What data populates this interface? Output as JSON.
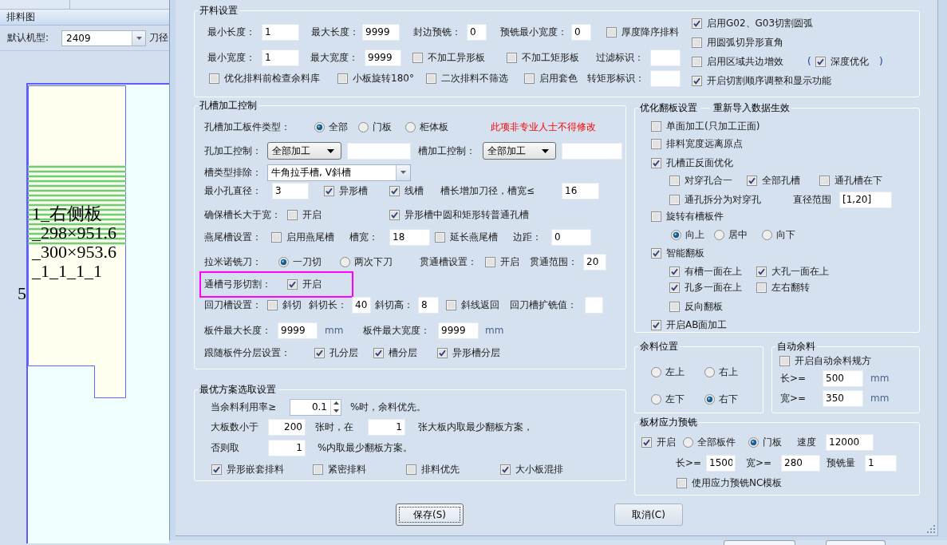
{
  "left_panel": {
    "title": "排料图",
    "machine_type": {
      "label": "默认机型:",
      "value": "2409"
    },
    "blade_label": "刀径",
    "layout": {
      "part_label_lines": [
        "1_右侧板",
        "_298×951.6",
        "_300×953.6",
        "_1_1_1_1"
      ],
      "sheet_number": "5"
    }
  },
  "dialog": {
    "groups": [
      {
        "title": "开料设置",
        "columns": [
          {
            "rows": [
              {
                "items": [
                  {
                    "kind": "label",
                    "text": "最小长度："
                  },
                  {
                    "kind": "input",
                    "value": "1"
                  },
                  {
                    "kind": "label",
                    "text": "最大长度："
                  },
                  {
                    "kind": "input",
                    "value": "9999"
                  },
                  {
                    "kind": "label",
                    "text": "封边预铣："
                  },
                  {
                    "kind": "input",
                    "value": "0"
                  },
                  {
                    "kind": "label",
                    "text": "预铣最小宽度："
                  },
                  {
                    "kind": "input",
                    "value": "0"
                  },
                  {
                    "kind": "checkbox",
                    "label": "厚度降序排料",
                    "checked": false
                  }
                ]
              },
              {
                "items": [
                  {
                    "kind": "label",
                    "text": "最小宽度："
                  },
                  {
                    "kind": "input",
                    "value": "1"
                  },
                  {
                    "kind": "label",
                    "text": "最大宽度："
                  },
                  {
                    "kind": "input",
                    "value": "9999"
                  },
                  {
                    "kind": "checkbox",
                    "label": "不加工异形板",
                    "checked": false
                  },
                  {
                    "kind": "checkbox",
                    "label": "不加工矩形板",
                    "checked": false
                  },
                  {
                    "kind": "label",
                    "text": "过滤标识："
                  },
                  {
                    "kind": "input"
                  }
                ]
              },
              {
                "items": [
                  {
                    "kind": "checkbox",
                    "label": "优化排料前检查余料库",
                    "checked": false
                  },
                  {
                    "kind": "checkbox",
                    "label": "小板旋转180°",
                    "checked": false
                  },
                  {
                    "kind": "checkbox",
                    "label": "二次排料不筛选",
                    "checked": false
                  },
                  {
                    "kind": "checkbox",
                    "label": "启用套色",
                    "checked": false
                  },
                  {
                    "kind": "label",
                    "text": "转矩形标识："
                  },
                  {
                    "kind": "input"
                  }
                ]
              }
            ]
          },
          {
            "rows": [
              {
                "items": [
                  {
                    "kind": "checkbox",
                    "label": "启用G02、G03切割圆弧",
                    "checked": true
                  }
                ]
              },
              {
                "items": [
                  {
                    "kind": "checkbox",
                    "label": "用圆弧切异形直角",
                    "checked": false
                  }
                ]
              },
              {
                "items": [
                  {
                    "kind": "checkbox",
                    "label": "启用区域共边增效",
                    "checked": false
                  },
                  {
                    "kind": "symbol",
                    "text": "("
                  },
                  {
                    "kind": "checkbox",
                    "label": "深度优化",
                    "checked": true
                  },
                  {
                    "kind": "symbol",
                    "text": ")"
                  }
                ]
              },
              {
                "items": [
                  {
                    "kind": "checkbox",
                    "label": "开启切割顺序调整和显示功能",
                    "checked": true
                  }
                ]
              }
            ]
          }
        ]
      },
      {
        "title": "孔槽加工控制",
        "rows": [
          {
            "highlighted": false,
            "items": [
              {
                "kind": "label",
                "text": "孔槽加工板件类型："
              },
              {
                "kind": "radio",
                "label": "全部",
                "selected": true
              },
              {
                "kind": "radio",
                "label": "门板",
                "selected": false
              },
              {
                "kind": "radio",
                "label": "柜体板",
                "selected": false
              },
              {
                "kind": "warning",
                "text": "此项非专业人士不得修改"
              }
            ]
          },
          {
            "highlighted": false,
            "items": [
              {
                "kind": "label",
                "text": "孔加工控制："
              },
              {
                "kind": "select",
                "value": "全部加工"
              },
              {
                "kind": "input"
              },
              {
                "kind": "label",
                "text": "槽加工控制："
              },
              {
                "kind": "select",
                "value": "全部加工"
              },
              {
                "kind": "input"
              }
            ]
          },
          {
            "highlighted": false,
            "items": [
              {
                "kind": "label",
                "text": "槽类型排除："
              },
              {
                "kind": "combo",
                "value": "牛角拉手槽, V斜槽"
              }
            ]
          },
          {
            "highlighted": false,
            "items": [
              {
                "kind": "label",
                "text": "最小孔直径："
              },
              {
                "kind": "input",
                "value": "3"
              },
              {
                "kind": "checkbox",
                "label": "异形槽",
                "checked": true
              },
              {
                "kind": "checkbox",
                "label": "线槽",
                "checked": true
              },
              {
                "kind": "label",
                "text": "槽长增加刀径，槽宽≤"
              },
              {
                "kind": "input",
                "value": "16"
              }
            ]
          },
          {
            "highlighted": false,
            "items": [
              {
                "kind": "label",
                "text": "确保槽长大于宽："
              },
              {
                "kind": "checkbox",
                "label": "开启",
                "checked": false
              },
              {
                "kind": "checkbox",
                "label": "异形槽中圆和矩形转普通孔槽",
                "checked": true
              }
            ]
          },
          {
            "highlighted": false,
            "items": [
              {
                "kind": "label",
                "text": "燕尾槽设置："
              },
              {
                "kind": "checkbox",
                "label": "启用燕尾槽",
                "checked": false
              },
              {
                "kind": "label",
                "text": "槽宽："
              },
              {
                "kind": "input",
                "value": "18"
              },
              {
                "kind": "checkbox",
                "label": "延长燕尾槽",
                "checked": false
              },
              {
                "kind": "label",
                "text": "边距："
              },
              {
                "kind": "input",
                "value": "0"
              }
            ]
          },
          {
            "highlighted": false,
            "items": [
              {
                "kind": "label",
                "text": "拉米诺铣刀："
              },
              {
                "kind": "radio",
                "label": "一刀切",
                "selected": true
              },
              {
                "kind": "radio",
                "label": "两次下刀",
                "selected": false
              },
              {
                "kind": "label",
                "text": "贯通槽设置："
              },
              {
                "kind": "checkbox",
                "label": "开启",
                "checked": false
              },
              {
                "kind": "label",
                "text": "贯通范围："
              },
              {
                "kind": "input",
                "value": "20"
              }
            ]
          },
          {
            "highlighted": true,
            "items": [
              {
                "kind": "label",
                "text": "通槽弓形切割："
              },
              {
                "kind": "checkbox",
                "label": "开启",
                "checked": true
              }
            ]
          },
          {
            "highlighted": false,
            "items": [
              {
                "kind": "label",
                "text": "回刀槽设置："
              },
              {
                "kind": "checkbox",
                "label": "斜切",
                "checked": false
              },
              {
                "kind": "label",
                "text": "斜切长："
              },
              {
                "kind": "input",
                "value": "40"
              },
              {
                "kind": "label",
                "text": "斜切高："
              },
              {
                "kind": "input",
                "value": "8"
              },
              {
                "kind": "checkbox",
                "label": "斜线返回",
                "checked": false
              },
              {
                "kind": "label",
                "text": "回刀槽扩铣值："
              },
              {
                "kind": "input"
              }
            ]
          },
          {
            "highlighted": false,
            "items": [
              {
                "kind": "label",
                "text": "板件最大长度："
              },
              {
                "kind": "input",
                "value": "9999"
              },
              {
                "kind": "unit",
                "text": "mm"
              },
              {
                "kind": "label",
                "text": "板件最大宽度："
              },
              {
                "kind": "input",
                "value": "9999"
              },
              {
                "kind": "unit",
                "text": "mm"
              }
            ]
          },
          {
            "highlighted": false,
            "items": [
              {
                "kind": "label",
                "text": "跟随板件分层设置："
              },
              {
                "kind": "checkbox",
                "label": "孔分层",
                "checked": true
              },
              {
                "kind": "checkbox",
                "label": "槽分层",
                "checked": true
              },
              {
                "kind": "checkbox",
                "label": "异形槽分层",
                "checked": true
              }
            ]
          }
        ]
      },
      {
        "title": "最优方案选取设置",
        "rows": [
          {
            "items": [
              {
                "kind": "label",
                "text": "当余料利用率≥"
              },
              {
                "kind": "spinner",
                "value": "0.1"
              },
              {
                "kind": "label",
                "text": "%时，余料优先。"
              }
            ]
          },
          {
            "items": [
              {
                "kind": "label",
                "text": "大板数小于"
              },
              {
                "kind": "number",
                "value": "200"
              },
              {
                "kind": "label",
                "text": "张时，在"
              },
              {
                "kind": "number",
                "value": "1"
              },
              {
                "kind": "label",
                "text": "张大板内取最少翻板方案，"
              }
            ]
          },
          {
            "items": [
              {
                "kind": "label",
                "text": "否则取"
              },
              {
                "kind": "number",
                "value": "1"
              },
              {
                "kind": "label",
                "text": "%内取最少翻板方案。"
              }
            ]
          },
          {
            "items": [
              {
                "kind": "checkbox",
                "label": "异形嵌套排料",
                "checked": true
              },
              {
                "kind": "checkbox",
                "label": "紧密排料",
                "checked": false
              },
              {
                "kind": "checkbox",
                "label": "排料优先",
                "checked": false
              },
              {
                "kind": "checkbox",
                "label": "大小板混排",
                "checked": true
              }
            ]
          }
        ]
      },
      {
        "title": "优化翻板设置",
        "note": "重新导入数据生效",
        "rows": [
          {
            "items": [
              {
                "kind": "checkbox",
                "label": "单面加工(只加工正面)",
                "checked": false
              }
            ]
          },
          {
            "items": [
              {
                "kind": "checkbox",
                "label": "排料宽度远离原点",
                "checked": false
              }
            ]
          },
          {
            "items": [
              {
                "kind": "checkbox",
                "label": "孔槽正反面优化",
                "checked": true
              }
            ],
            "children": [
              {
                "items": [
                  {
                    "kind": "checkbox",
                    "label": "对穿孔合一",
                    "checked": false
                  },
                  {
                    "kind": "checkbox",
                    "label": "全部孔槽",
                    "checked": true
                  },
                  {
                    "kind": "checkbox",
                    "label": "通孔槽在下",
                    "checked": false
                  }
                ]
              },
              {
                "items": [
                  {
                    "kind": "checkbox",
                    "label": "通孔拆分为对穿孔",
                    "checked": false
                  },
                  {
                    "kind": "label",
                    "text": "直径范围"
                  },
                  {
                    "kind": "input",
                    "value": "[1,20]"
                  }
                ]
              }
            ]
          },
          {
            "items": [
              {
                "kind": "checkbox",
                "label": "旋转有槽板件",
                "checked": false
              }
            ],
            "children": [
              {
                "items": [
                  {
                    "kind": "radio",
                    "label": "向上",
                    "selected": true
                  },
                  {
                    "kind": "radio",
                    "label": "居中",
                    "selected": false
                  },
                  {
                    "kind": "radio",
                    "label": "向下",
                    "selected": false
                  }
                ]
              }
            ]
          },
          {
            "items": [
              {
                "kind": "checkbox",
                "label": "智能翻板",
                "checked": true
              }
            ],
            "children": [
              {
                "items": [
                  {
                    "kind": "checkbox",
                    "label": "有槽一面在上",
                    "checked": true
                  },
                  {
                    "kind": "checkbox",
                    "label": "大孔一面在上",
                    "checked": true
                  }
                ]
              },
              {
                "items": [
                  {
                    "kind": "checkbox",
                    "label": "孔多一面在上",
                    "checked": true
                  },
                  {
                    "kind": "checkbox",
                    "label": "左右翻转",
                    "checked": false
                  }
                ]
              },
              {
                "items": [
                  {
                    "kind": "checkbox",
                    "label": "反向翻板",
                    "checked": false
                  }
                ]
              }
            ]
          },
          {
            "items": [
              {
                "kind": "checkbox",
                "label": "开启AB面加工",
                "checked": true
              }
            ]
          }
        ]
      },
      {
        "title": "余料位置",
        "rows": [
          {
            "items": [
              {
                "kind": "radio",
                "label": "左上",
                "selected": false
              },
              {
                "kind": "radio",
                "label": "右上",
                "selected": false
              }
            ]
          },
          {
            "items": [
              {
                "kind": "radio",
                "label": "左下",
                "selected": false
              },
              {
                "kind": "radio",
                "label": "右下",
                "selected": true
              }
            ]
          }
        ]
      },
      {
        "title": "自动余料",
        "rows": [
          {
            "items": [
              {
                "kind": "checkbox",
                "label": "开启自动余料规方",
                "checked": false
              }
            ]
          },
          {
            "items": [
              {
                "kind": "label",
                "text": "长>="
              },
              {
                "kind": "input",
                "value": "500"
              },
              {
                "kind": "unit",
                "text": "mm"
              }
            ]
          },
          {
            "items": [
              {
                "kind": "label",
                "text": "宽>="
              },
              {
                "kind": "input",
                "value": "350"
              },
              {
                "kind": "unit",
                "text": "mm"
              }
            ]
          }
        ]
      },
      {
        "title": "板材应力预铣",
        "rows": [
          {
            "items": [
              {
                "kind": "checkbox",
                "label": "开启",
                "checked": true
              },
              {
                "kind": "radio",
                "label": "全部板件",
                "selected": false
              },
              {
                "kind": "radio",
                "label": "门板",
                "selected": true
              },
              {
                "kind": "label",
                "text": "速度"
              },
              {
                "kind": "input",
                "value": "12000"
              }
            ]
          },
          {
            "items": [
              {
                "kind": "label",
                "text": "长>="
              },
              {
                "kind": "input",
                "value": "1500"
              },
              {
                "kind": "label",
                "text": "宽>="
              },
              {
                "kind": "input",
                "value": "280"
              },
              {
                "kind": "label",
                "text": "预铣量"
              },
              {
                "kind": "input",
                "value": "1"
              }
            ]
          },
          {
            "items": [
              {
                "kind": "checkbox",
                "label": "使用应力预铣NC模板",
                "checked": false
              }
            ]
          }
        ]
      }
    ],
    "buttons": [
      {
        "label": "保存(S)",
        "focused": true
      },
      {
        "label": "取消(C)",
        "focused": false
      }
    ]
  }
}
